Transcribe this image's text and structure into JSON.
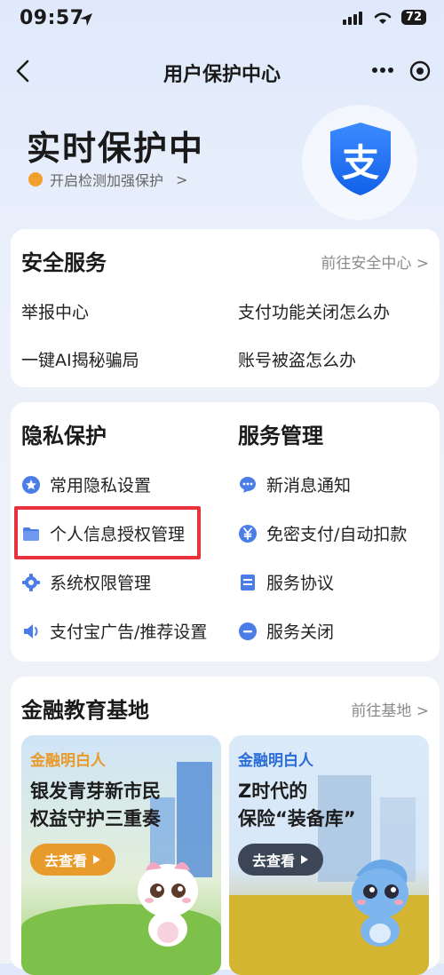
{
  "status_bar": {
    "time": "09:57",
    "battery": "72"
  },
  "nav": {
    "title": "用户保护中心"
  },
  "hero": {
    "title": "实时保护中",
    "subtitle": "开启检测加强保护",
    "subtitle_arrow": ">",
    "badge_char": "支"
  },
  "security": {
    "title": "安全服务",
    "link": "前往安全中心 >",
    "items": [
      "举报中心",
      "支付功能关闭怎么办",
      "一键AI揭秘骗局",
      "账号被盗怎么办"
    ]
  },
  "privacy": {
    "title": "隐私保护",
    "items": [
      {
        "label": "常用隐私设置",
        "icon": "star-shield-icon"
      },
      {
        "label": "个人信息授权管理",
        "icon": "folder-icon"
      },
      {
        "label": "系统权限管理",
        "icon": "gear-icon"
      },
      {
        "label": "支付宝广告/推荐设置",
        "icon": "speaker-icon"
      }
    ]
  },
  "service": {
    "title": "服务管理",
    "items": [
      {
        "label": "新消息通知",
        "icon": "chat-icon"
      },
      {
        "label": "免密支付/自动扣款",
        "icon": "yen-icon"
      },
      {
        "label": "服务协议",
        "icon": "document-icon"
      },
      {
        "label": "服务关闭",
        "icon": "minus-icon"
      }
    ]
  },
  "finance": {
    "title": "金融教育基地",
    "link": "前往基地 >",
    "tiles": [
      {
        "kicker": "金融明白人",
        "line1": "银发青芽新市民",
        "line2": "权益守护三重奏",
        "button": "去查看"
      },
      {
        "kicker": "金融明白人",
        "line1": "Z时代的",
        "line2": "保险“装备库”",
        "button": "去查看"
      }
    ]
  },
  "colors": {
    "accent_blue": "#1677ff",
    "highlight_red": "#e8323c",
    "tile1_kicker": "#e89a2a",
    "tile2_kicker": "#2a6bd8"
  }
}
